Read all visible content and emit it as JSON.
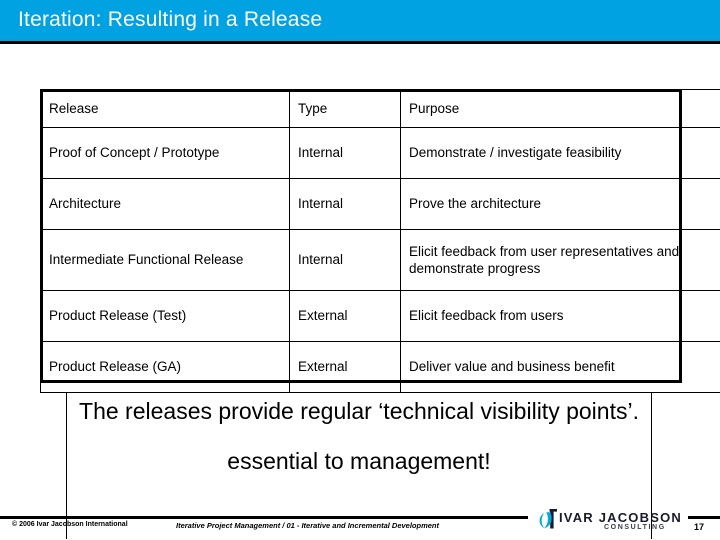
{
  "slide": {
    "title": "Iteration: Resulting in a Release",
    "accent_color": "#00A2E1",
    "title_text_color": "#FFFFFF"
  },
  "table": {
    "headers": [
      "Release",
      "Type",
      "Purpose"
    ],
    "rows": [
      {
        "release": "Proof of Concept / Prototype",
        "type": "Internal",
        "purpose": "Demonstrate / investigate feasibility"
      },
      {
        "release": "Architecture",
        "type": "Internal",
        "purpose": "Prove the architecture"
      },
      {
        "release": "Intermediate Functional Release",
        "type": "Internal",
        "purpose": "Elicit feedback from user representatives and demonstrate progress"
      },
      {
        "release": "Product Release (Test)",
        "type": "External",
        "purpose": "Elicit feedback from users"
      },
      {
        "release": "Product Release (GA)",
        "type": "External",
        "purpose": "Deliver value and business benefit"
      }
    ]
  },
  "body": {
    "statement": "The releases provide regular ‘technical visibility points’.",
    "emphasis": "essential to management!"
  },
  "footer": {
    "copyright": "© 2006 Ivar Jacobson International",
    "course": "Iterative Project Management / 01 - Iterative and Incremental Development",
    "page_number": "17",
    "logo_wordmark": "IVAR JACOBSON",
    "logo_subtext": "CONSULTING",
    "logo_mark_color": "#00A8E0",
    "logo_text_color": "#1A1A2E"
  }
}
